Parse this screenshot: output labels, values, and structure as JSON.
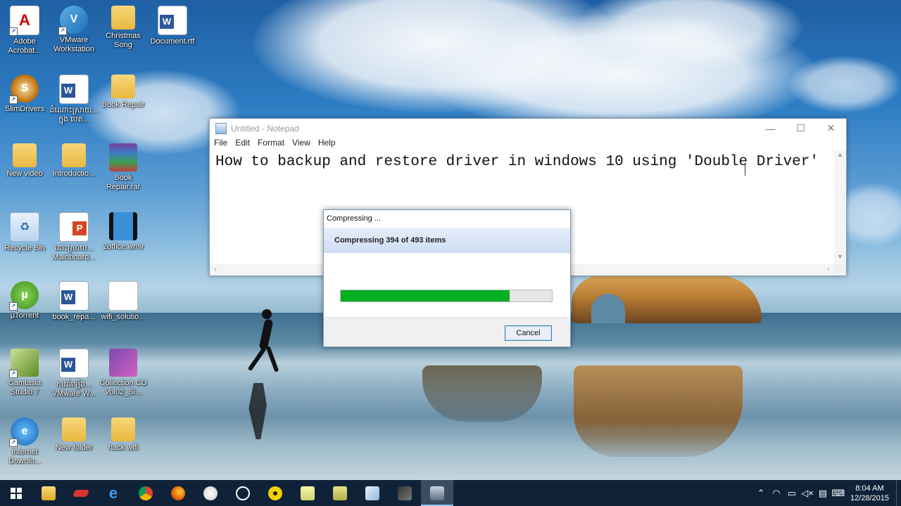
{
  "desktop": {
    "icons": [
      {
        "label": "Adobe Acrobat...",
        "glyph": "A"
      },
      {
        "label": "VMware Workstation",
        "glyph": "V"
      },
      {
        "label": "Christmas Song",
        "glyph": ""
      },
      {
        "label": "Document.rtf",
        "glyph": "W"
      },
      {
        "label": "SlimDrivers",
        "glyph": "S"
      },
      {
        "label": "ដំណោះស្រាយ... ក្នុង បេត...",
        "glyph": "W"
      },
      {
        "label": "Book Repair",
        "glyph": ""
      },
      {
        "label": "New video",
        "glyph": ""
      },
      {
        "label": "Introductio...",
        "glyph": ""
      },
      {
        "label": "Book Repair.rar",
        "glyph": ""
      },
      {
        "label": "Recycle Bin",
        "glyph": "♻"
      },
      {
        "label": "ដោះស្រាយ... Mainboard...",
        "glyph": "P"
      },
      {
        "label": "2office.wmv",
        "glyph": ""
      },
      {
        "label": "µTorrent",
        "glyph": "µ"
      },
      {
        "label": "book_repa...",
        "glyph": "W"
      },
      {
        "label": "wifi_solutio...",
        "glyph": ""
      },
      {
        "label": "Camtasia Studio 7",
        "glyph": ""
      },
      {
        "label": "ការដំឡើង... VMware W...",
        "glyph": "W"
      },
      {
        "label": "Collection CD Vol02_Si...",
        "glyph": ""
      },
      {
        "label": "Internet Downlo...",
        "glyph": "e"
      },
      {
        "label": "New folder",
        "glyph": ""
      },
      {
        "label": "hack wifi",
        "glyph": ""
      }
    ]
  },
  "notepad": {
    "title": "Untitled - Notepad",
    "menu": [
      "File",
      "Edit",
      "Format",
      "View",
      "Help"
    ],
    "content": "How to backup and restore driver in windows 10 using 'Double Driver'",
    "controls": {
      "minimize": "—",
      "maximize": "☐",
      "close": "✕"
    }
  },
  "dialog": {
    "title": "Compressing ...",
    "status": "Compressing 394 of 493 items",
    "progress_percent": 80,
    "cancel_label": "Cancel"
  },
  "taskbar": {
    "items": [
      "start",
      "file-explorer",
      "app-red",
      "edge",
      "chrome",
      "firefox",
      "app-paint",
      "cortana-circle",
      "app-yellow",
      "app-folder2",
      "app-notes",
      "app-book",
      "app-tool",
      "double-driver"
    ],
    "tray_icons": [
      "chevron-up",
      "network",
      "battery",
      "volume",
      "message",
      "keyboard"
    ],
    "time": "8:04 AM",
    "date": "12/28/2015"
  },
  "colors": {
    "progress_fill": "#06b025",
    "taskbar_bg": "#0f2238"
  }
}
